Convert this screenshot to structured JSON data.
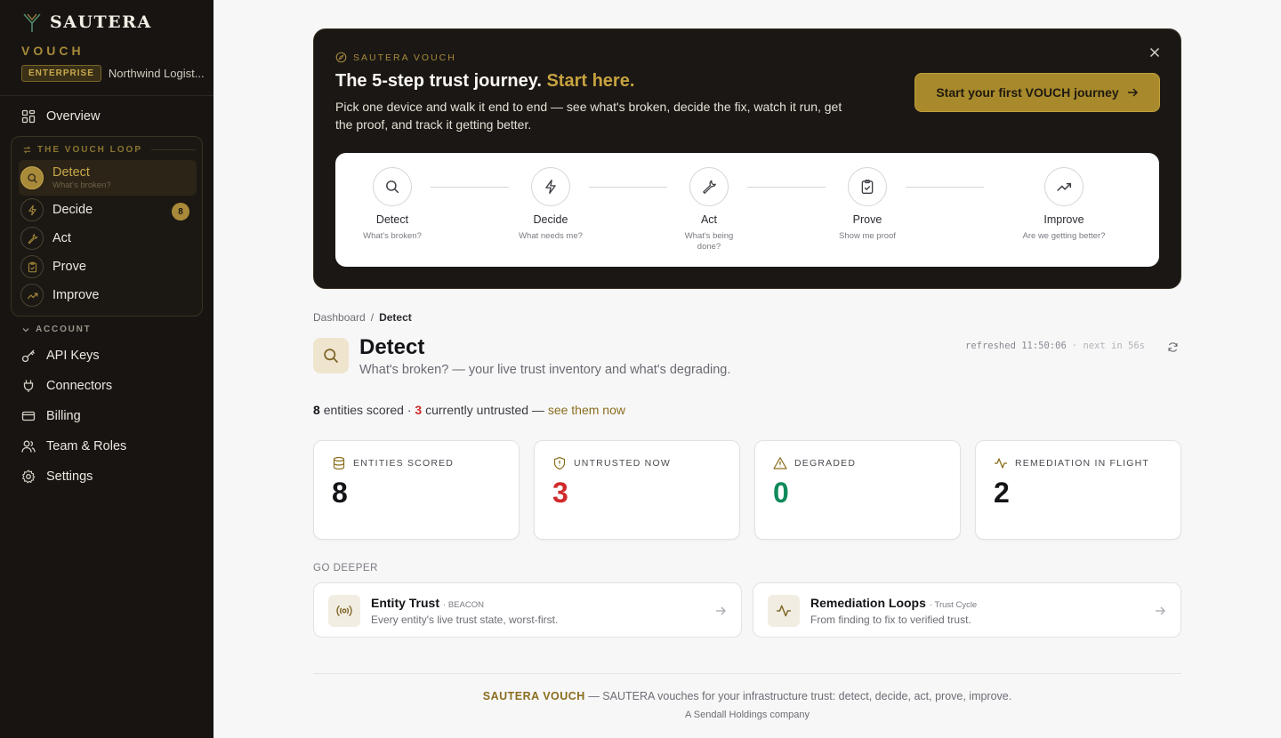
{
  "sidebar": {
    "brand": "SAUTERA",
    "product": "VOUCH",
    "plan_badge": "ENTERPRISE",
    "org": "Northwind Logist...",
    "overview": "Overview",
    "loop_title": "THE VOUCH LOOP",
    "loop": [
      {
        "label": "Detect",
        "sub": "What's broken?",
        "icon": "search-icon"
      },
      {
        "label": "Decide",
        "badge": "8",
        "icon": "lightning-icon"
      },
      {
        "label": "Act",
        "icon": "wrench-icon"
      },
      {
        "label": "Prove",
        "icon": "clipboard-check-icon"
      },
      {
        "label": "Improve",
        "icon": "trending-up-icon"
      }
    ],
    "account_title": "ACCOUNT",
    "account": [
      {
        "label": "API Keys",
        "icon": "key-icon"
      },
      {
        "label": "Connectors",
        "icon": "plug-icon"
      },
      {
        "label": "Billing",
        "icon": "credit-card-icon"
      },
      {
        "label": "Team & Roles",
        "icon": "users-icon"
      },
      {
        "label": "Settings",
        "icon": "gear-icon"
      }
    ]
  },
  "banner": {
    "eyebrow": "SAUTERA VOUCH",
    "title": "The 5-step trust journey.",
    "title_highlight": "Start here.",
    "desc": "Pick one device and walk it end to end — see what's broken, decide the fix, watch it run, get the proof, and track it getting better.",
    "cta": "Start your first VOUCH journey",
    "steps": [
      {
        "name": "Detect",
        "sub": "What's broken?"
      },
      {
        "name": "Decide",
        "sub": "What needs me?"
      },
      {
        "name": "Act",
        "sub": "What's being done?"
      },
      {
        "name": "Prove",
        "sub": "Show me proof"
      },
      {
        "name": "Improve",
        "sub": "Are we getting better?"
      }
    ]
  },
  "breadcrumb": {
    "root": "Dashboard",
    "sep": "/",
    "current": "Detect"
  },
  "page": {
    "title": "Detect",
    "subtitle": "What's broken? — your live trust inventory and what's degrading.",
    "refreshed": "refreshed 11:50:06",
    "next": "· next in 56s"
  },
  "summary": {
    "scored": "8",
    "scored_text": "entities scored ·",
    "untrusted": "3",
    "untrusted_text": "currently untrusted —",
    "link": "see them now"
  },
  "kpis": [
    {
      "label": "ENTITIES SCORED",
      "value": "8",
      "icon": "database-icon"
    },
    {
      "label": "UNTRUSTED NOW",
      "value": "3",
      "icon": "shield-icon"
    },
    {
      "label": "DEGRADED",
      "value": "0",
      "icon": "warning-icon"
    },
    {
      "label": "REMEDIATION IN FLIGHT",
      "value": "2",
      "icon": "activity-icon"
    }
  ],
  "deeper": {
    "title": "GO DEEPER",
    "cards": [
      {
        "title": "Entity Trust",
        "tag": "· BEACON",
        "sub": "Every entity's live trust state, worst-first.",
        "icon": "broadcast-icon"
      },
      {
        "title": "Remediation Loops",
        "tag": "· Trust Cycle",
        "sub": "From finding to fix to verified trust.",
        "icon": "activity-icon"
      }
    ]
  },
  "footer": {
    "brand": "SAUTERA VOUCH",
    "text": "— SAUTERA vouches for your infrastructure trust: detect, decide, act, prove, improve.",
    "sub": "A Sendall Holdings company"
  },
  "colors": {
    "sidebar_bg": "#171412",
    "accent_gold": "#a88a2c",
    "danger_red": "#d12a2a",
    "success_green": "#0f8a5a"
  }
}
